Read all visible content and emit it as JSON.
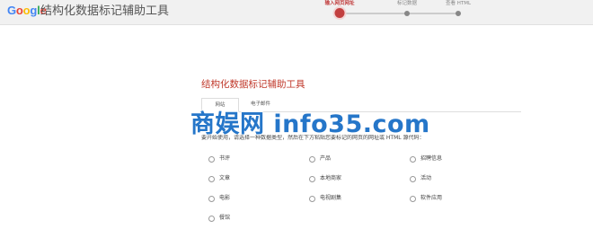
{
  "header": {
    "logo_text": "Google",
    "title": "结构化数据标记辅助工具"
  },
  "stepper": {
    "steps": [
      {
        "label": "输入网页网址",
        "active": true
      },
      {
        "label": "标记数据",
        "active": false
      },
      {
        "label": "查看 HTML",
        "active": false
      }
    ]
  },
  "main": {
    "title": "结构化数据标记辅助工具",
    "tabs": [
      {
        "label": "网站",
        "active": true
      },
      {
        "label": "电子邮件",
        "active": false
      }
    ],
    "instruction": "要开始使用，请选择一种数据类型，然后在下方粘贴您要标记的网页的网址或 HTML 源代码：",
    "options": [
      {
        "label": "书评",
        "selected": false
      },
      {
        "label": "产品",
        "selected": false
      },
      {
        "label": "招聘信息",
        "selected": false
      },
      {
        "label": "文章",
        "selected": false
      },
      {
        "label": "本地商家",
        "selected": false
      },
      {
        "label": "活动",
        "selected": false
      },
      {
        "label": "电影",
        "selected": false
      },
      {
        "label": "电视剧集",
        "selected": false
      },
      {
        "label": "软件应用",
        "selected": false
      },
      {
        "label": "餐馆",
        "selected": false
      }
    ]
  },
  "watermark": {
    "text": "商娱网 info35.com"
  },
  "colors": {
    "accent": "#c23f3f",
    "title_red": "#c0392b",
    "watermark_blue": "#1a6fc7",
    "header_bg": "#f1f1f1"
  }
}
